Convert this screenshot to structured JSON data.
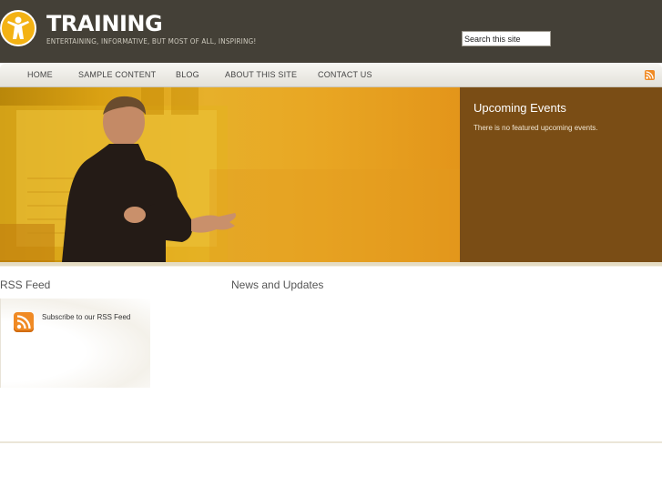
{
  "header": {
    "title": "TRAINING",
    "tagline": "ENTERTAINING, INFORMATIVE, BUT MOST OF ALL, INSPIRING!",
    "search_value": "Search this site"
  },
  "nav": {
    "items": [
      {
        "label": "HOME"
      },
      {
        "label": "SAMPLE CONTENT"
      },
      {
        "label": "BLOG"
      },
      {
        "label": "ABOUT THIS SITE"
      },
      {
        "label": "CONTACT US"
      }
    ],
    "rss_icon": "rss-icon"
  },
  "events": {
    "title": "Upcoming Events",
    "text": "There is no featured upcoming events."
  },
  "rss_section": {
    "heading": "RSS Feed",
    "link_text": "Subscribe to our RSS Feed",
    "icon": "rss-icon"
  },
  "news_section": {
    "heading": "News and Updates"
  },
  "colors": {
    "header_bg": "#444037",
    "accent": "#f3b214",
    "events_bg": "#7a4d15",
    "rss_orange": "#f08a24"
  }
}
